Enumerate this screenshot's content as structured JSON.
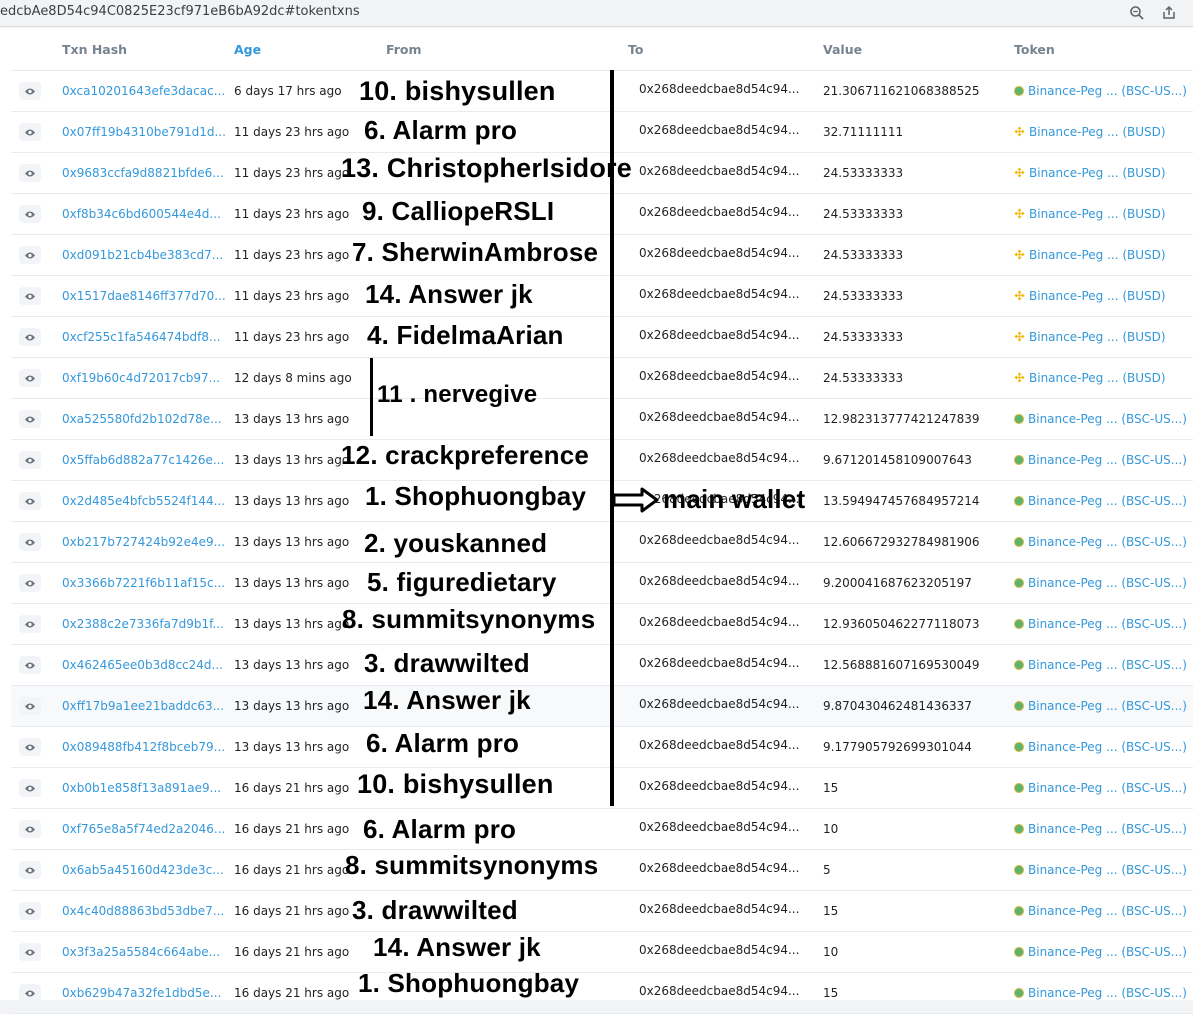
{
  "browser": {
    "url": "edcbAe8D54c94C0825E23cf971eB6bA92dc#tokentxns"
  },
  "table": {
    "headers": {
      "txn_hash": "Txn Hash",
      "age": "Age",
      "from": "From",
      "to": "To",
      "value": "Value",
      "token": "Token"
    },
    "direction": "IN",
    "rows": [
      {
        "hash": "0xca10201643efe3dacac...",
        "age": "6 days 17 hrs ago",
        "to": "0x268deedcbae8d54c94...",
        "value": "21.306711621068388525",
        "token": "Binance-Peg ... (BSC-US...)",
        "coin": "usd"
      },
      {
        "hash": "0x07ff19b4310be791d1d...",
        "age": "11 days 23 hrs ago",
        "to": "0x268deedcbae8d54c94...",
        "value": "32.71111111",
        "token": "Binance-Peg ... (BUSD)",
        "coin": "busd"
      },
      {
        "hash": "0x9683ccfa9d8821bfde6...",
        "age": "11 days 23 hrs ago",
        "to": "0x268deedcbae8d54c94...",
        "value": "24.53333333",
        "token": "Binance-Peg ... (BUSD)",
        "coin": "busd"
      },
      {
        "hash": "0xf8b34c6bd600544e4d...",
        "age": "11 days 23 hrs ago",
        "to": "0x268deedcbae8d54c94...",
        "value": "24.53333333",
        "token": "Binance-Peg ... (BUSD)",
        "coin": "busd"
      },
      {
        "hash": "0xd091b21cb4be383cd7...",
        "age": "11 days 23 hrs ago",
        "to": "0x268deedcbae8d54c94...",
        "value": "24.53333333",
        "token": "Binance-Peg ... (BUSD)",
        "coin": "busd"
      },
      {
        "hash": "0x1517dae8146ff377d70...",
        "age": "11 days 23 hrs ago",
        "to": "0x268deedcbae8d54c94...",
        "value": "24.53333333",
        "token": "Binance-Peg ... (BUSD)",
        "coin": "busd"
      },
      {
        "hash": "0xcf255c1fa546474bdf8...",
        "age": "11 days 23 hrs ago",
        "to": "0x268deedcbae8d54c94...",
        "value": "24.53333333",
        "token": "Binance-Peg ... (BUSD)",
        "coin": "busd"
      },
      {
        "hash": "0xf19b60c4d72017cb97...",
        "age": "12 days 8 mins ago",
        "to": "0x268deedcbae8d54c94...",
        "value": "24.53333333",
        "token": "Binance-Peg ... (BUSD)",
        "coin": "busd"
      },
      {
        "hash": "0xa525580fd2b102d78e...",
        "age": "13 days 13 hrs ago",
        "to": "0x268deedcbae8d54c94...",
        "value": "12.982313777421247839",
        "token": "Binance-Peg ... (BSC-US...)",
        "coin": "usd"
      },
      {
        "hash": "0x5ffab6d882a77c1426e...",
        "age": "13 days 13 hrs ago",
        "to": "0x268deedcbae8d54c94...",
        "value": "9.671201458109007643",
        "token": "Binance-Peg ... (BSC-US...)",
        "coin": "usd"
      },
      {
        "hash": "0x2d485e4bfcb5524f144...",
        "age": "13 days 13 hrs ago",
        "to": "0x268deedcbae8d54c94...",
        "value": "13.594947457684957214",
        "token": "Binance-Peg ... (BSC-US...)",
        "coin": "usd"
      },
      {
        "hash": "0xb217b727424b92e4e9...",
        "age": "13 days 13 hrs ago",
        "to": "0x268deedcbae8d54c94...",
        "value": "12.606672932784981906",
        "token": "Binance-Peg ... (BSC-US...)",
        "coin": "usd"
      },
      {
        "hash": "0x3366b7221f6b11af15c...",
        "age": "13 days 13 hrs ago",
        "to": "0x268deedcbae8d54c94...",
        "value": "9.200041687623205197",
        "token": "Binance-Peg ... (BSC-US...)",
        "coin": "usd"
      },
      {
        "hash": "0x2388c2e7336fa7d9b1f...",
        "age": "13 days 13 hrs ago",
        "to": "0x268deedcbae8d54c94...",
        "value": "12.936050462277118073",
        "token": "Binance-Peg ... (BSC-US...)",
        "coin": "usd"
      },
      {
        "hash": "0x462465ee0b3d8cc24d...",
        "age": "13 days 13 hrs ago",
        "to": "0x268deedcbae8d54c94...",
        "value": "12.568881607169530049",
        "token": "Binance-Peg ... (BSC-US...)",
        "coin": "usd"
      },
      {
        "hash": "0xff17b9a1ee21baddc63...",
        "age": "13 days 13 hrs ago",
        "to": "0x268deedcbae8d54c94...",
        "value": "9.870430462481436337",
        "token": "Binance-Peg ... (BSC-US...)",
        "coin": "usd"
      },
      {
        "hash": "0x089488fb412f8bceb79...",
        "age": "13 days 13 hrs ago",
        "to": "0x268deedcbae8d54c94...",
        "value": "9.177905792699301044",
        "token": "Binance-Peg ... (BSC-US...)",
        "coin": "usd"
      },
      {
        "hash": "0xb0b1e858f13a891ae9...",
        "age": "16 days 21 hrs ago",
        "to": "0x268deedcbae8d54c94...",
        "value": "15",
        "token": "Binance-Peg ... (BSC-US...)",
        "coin": "usd"
      },
      {
        "hash": "0xf765e8a5f74ed2a2046...",
        "age": "16 days 21 hrs ago",
        "to": "0x268deedcbae8d54c94...",
        "value": "10",
        "token": "Binance-Peg ... (BSC-US...)",
        "coin": "usd"
      },
      {
        "hash": "0x6ab5a45160d423de3c...",
        "age": "16 days 21 hrs ago",
        "to": "0x268deedcbae8d54c94...",
        "value": "5",
        "token": "Binance-Peg ... (BSC-US...)",
        "coin": "usd"
      },
      {
        "hash": "0x4c40d88863bd53dbe7...",
        "age": "16 days 21 hrs ago",
        "to": "0x268deedcbae8d54c94...",
        "value": "15",
        "token": "Binance-Peg ... (BSC-US...)",
        "coin": "usd"
      },
      {
        "hash": "0x3f3a25a5584c664abe...",
        "age": "16 days 21 hrs ago",
        "to": "0x268deedcbae8d54c94...",
        "value": "10",
        "token": "Binance-Peg ... (BSC-US...)",
        "coin": "usd"
      },
      {
        "hash": "0xb629b47a32fe1dbd5e...",
        "age": "16 days 21 hrs ago",
        "to": "0x268deedcbae8d54c94...",
        "value": "15",
        "token": "Binance-Peg ... (BSC-US...)",
        "coin": "usd"
      }
    ]
  },
  "annotations": {
    "labels": [
      "10. bishysullen",
      "6. Alarm pro",
      "13. ChristopherIsidore",
      "9. CalliopeRSLI",
      "7. SherwinAmbrose",
      "14. Answer jk",
      "4. FidelmaArian",
      "11 . nervegive",
      "12. crackpreference",
      "1. Shophuongbay",
      "2. youskanned",
      "5. figuredietary",
      "8. summitsynonyms",
      "3. drawwilted",
      "14. Answer jk",
      "6. Alarm pro",
      "10. bishysullen",
      "6. Alarm pro",
      "8. summitsynonyms",
      "3. drawwilted",
      "14. Answer jk",
      "1. Shophuongbay"
    ],
    "main_wallet": "main wallet"
  }
}
